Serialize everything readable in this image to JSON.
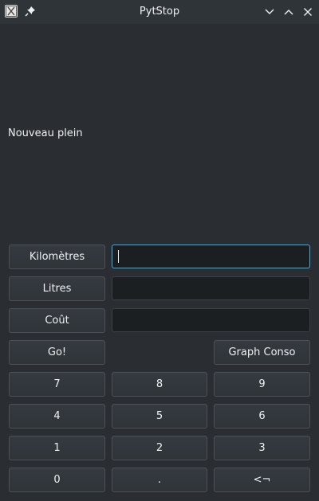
{
  "window": {
    "title": "PytStop",
    "app_icon": "x-app-icon",
    "pin_icon": "pin-icon",
    "controls": [
      "minimize-icon",
      "maximize-icon",
      "close-icon"
    ]
  },
  "form": {
    "heading": "Nouveau plein",
    "kilometres_label": "Kilomètres",
    "litres_label": "Litres",
    "cout_label": "Coût",
    "kilometres_value": "",
    "litres_value": "",
    "cout_value": ""
  },
  "actions": {
    "go_label": "Go!",
    "graph_label": "Graph Conso"
  },
  "keypad": {
    "k7": "7",
    "k8": "8",
    "k9": "9",
    "k4": "4",
    "k5": "5",
    "k6": "6",
    "k1": "1",
    "k2": "2",
    "k3": "3",
    "k0": "0",
    "kdot": ".",
    "kback": "<¬"
  },
  "colors": {
    "background": "#2a2e32",
    "button": "#31363b",
    "field": "#1c1f22",
    "focus": "#3daee9",
    "text": "#eff0f1"
  }
}
